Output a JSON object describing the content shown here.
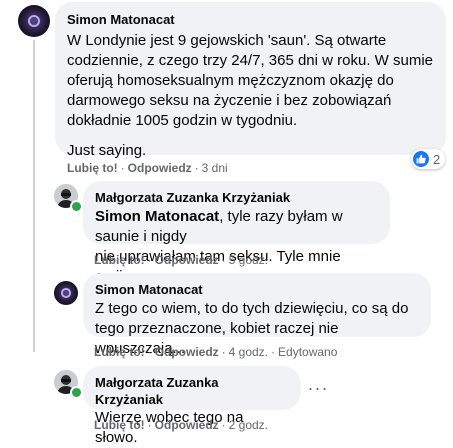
{
  "comments": [
    {
      "author": "Simon Matonacat",
      "text_lines": [
        "W Londynie jest 9 gejowskich 'saun'. Są otwarte",
        "codziennie, z czego trzy 24/7, 365 dni w roku. W sumie",
        "oferują homoseksualnym mężczyznom okazję do",
        "darmowego seksu na życzenie i bez zobowiązań",
        "dokładnie 1005 godzin w tygodniu.",
        "",
        "Just saying."
      ],
      "like_label": "Lubię to!",
      "reply_label": "Odpowiedz",
      "time": "3 dni",
      "reaction_count": "2"
    },
    {
      "author": "Małgorzata Zuzanka Krzyżaniak",
      "mention": "Simon Matonacat",
      "text_line1_rest": ", tyle razy byłam w saunie i nigdy",
      "text_line2": "nie uprawiałam tam seksu. Tyle mnie omija.",
      "like_label": "Lubię to!",
      "reply_label": "Odpowiedz",
      "time": "5 godz."
    },
    {
      "author": "Simon Matonacat",
      "text_lines": [
        "Z tego co wiem, to do tych dziewięciu, co są do",
        "tego przeznaczone, kobiet raczej nie wpuszczają..."
      ],
      "like_label": "Lubię to!",
      "reply_label": "Odpowiedz",
      "time": "4 godz.",
      "edited": "Edytowano"
    },
    {
      "author": "Małgorzata Zuzanka Krzyżaniak",
      "text": "Wierzę wobec tego na słowo.",
      "like_label": "Lubię to!",
      "reply_label": "Odpowiedz",
      "time": "2 godz.",
      "more_label": "···"
    }
  ],
  "colors": {
    "bubble": "#f0f2f5",
    "secondary_text": "#65676b",
    "like_blue": "#1877f2",
    "online_green": "#31a24c"
  }
}
